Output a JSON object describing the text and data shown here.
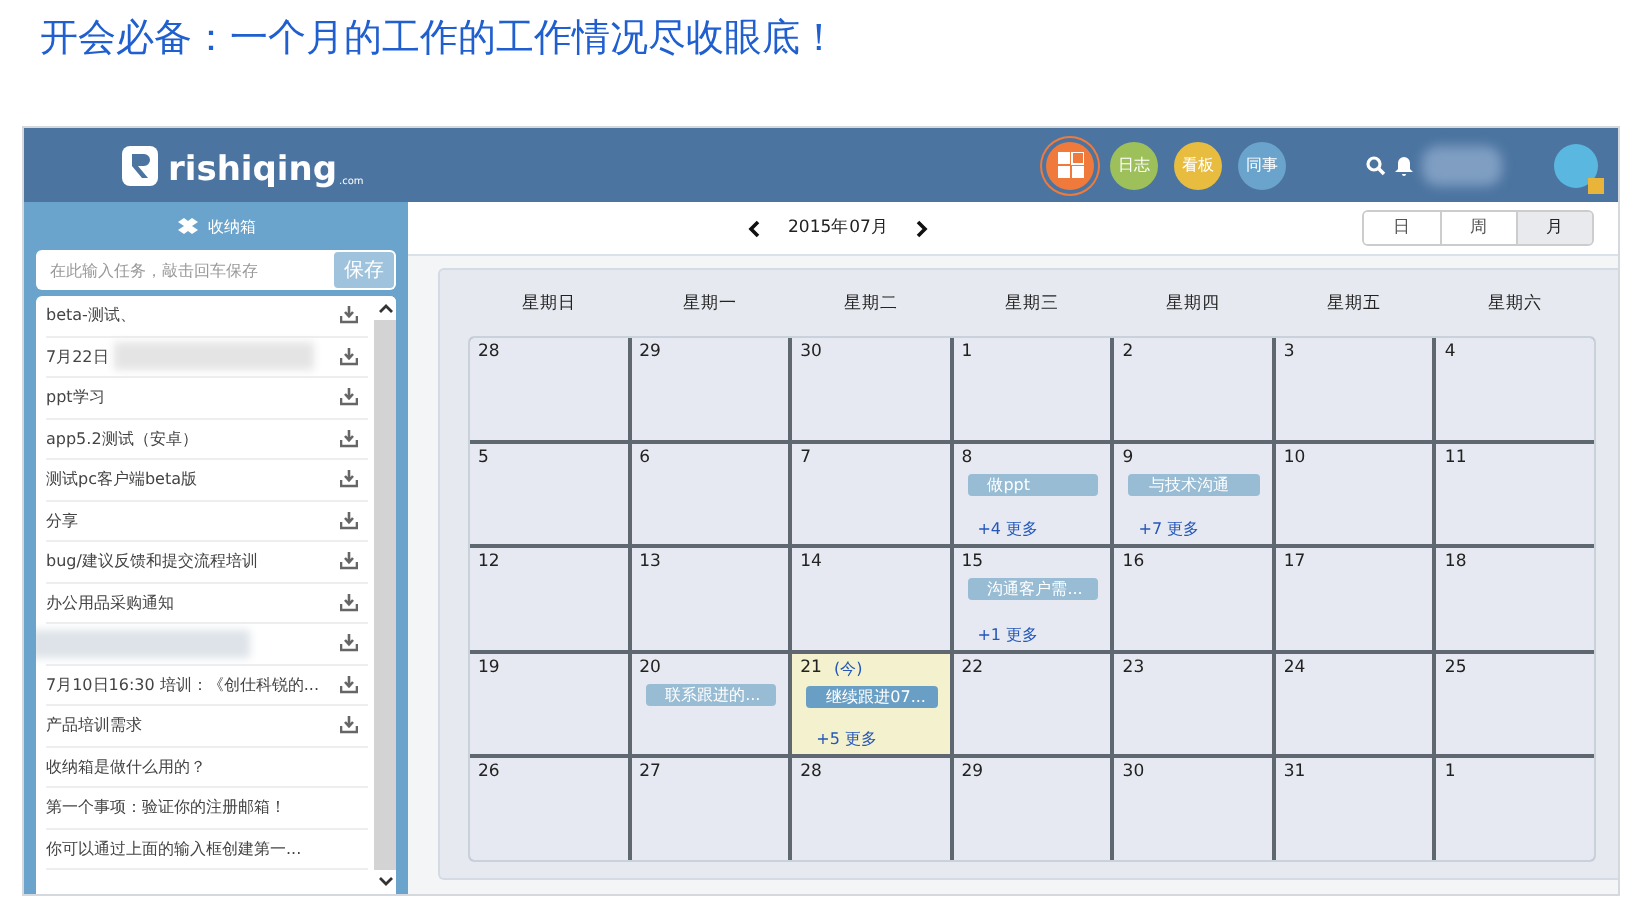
{
  "headline": "开会必备：一个月的工作的工作情况尽收眼底！",
  "header": {
    "logo": {
      "name": "rishiqing",
      "suffix": ".com"
    },
    "nav": [
      {
        "kind": "icon",
        "color": "#f07a3c",
        "selected": true
      },
      {
        "kind": "text",
        "label": "日志",
        "color": "#9dc05a",
        "selected": false
      },
      {
        "kind": "text",
        "label": "看板",
        "color": "#e8bd3f",
        "selected": false
      },
      {
        "kind": "text",
        "label": "同事",
        "color": "#6aa3cb",
        "selected": false
      }
    ]
  },
  "inbox": {
    "title": "收纳箱",
    "placeholder": "在此输入任务，敲击回车保存",
    "save": "保存",
    "items": [
      {
        "text": "beta-测试、",
        "download": true,
        "blurred": false
      },
      {
        "text": "7月22日",
        "download": true,
        "blurred": true
      },
      {
        "text": "ppt学习",
        "download": true,
        "blurred": false
      },
      {
        "text": "app5.2测试（安卓）",
        "download": true,
        "blurred": false
      },
      {
        "text": "测试pc客户端beta版",
        "download": true,
        "blurred": false
      },
      {
        "text": "分享",
        "download": true,
        "blurred": false
      },
      {
        "text": "bug/建议反馈和提交流程培训",
        "download": true,
        "blurred": false
      },
      {
        "text": "办公用品采购通知",
        "download": true,
        "blurred": false
      },
      {
        "download": true,
        "blurred": true
      },
      {
        "text": "7月10日16:30 培训：《创仕科锐的...",
        "download": true,
        "blurred": false
      },
      {
        "text": "产品培训需求",
        "download": true,
        "blurred": false
      },
      {
        "text": "收纳箱是做什么用的？",
        "download": false,
        "blurred": false
      },
      {
        "text": "第一个事项：验证你的注册邮箱！",
        "download": false,
        "blurred": false
      },
      {
        "text": "你可以通过上面的输入框创建第一...",
        "download": false,
        "blurred": false
      }
    ]
  },
  "calendar": {
    "title": "2015年07月",
    "views": [
      {
        "label": "日",
        "selected": false
      },
      {
        "label": "周",
        "selected": false
      },
      {
        "label": "月",
        "selected": true
      }
    ],
    "weekdays": [
      "星期日",
      "星期一",
      "星期二",
      "星期三",
      "星期四",
      "星期五",
      "星期六"
    ],
    "weeks": [
      [
        {
          "day": "28",
          "today": false
        },
        {
          "day": "29",
          "today": false
        },
        {
          "day": "30",
          "today": false
        },
        {
          "day": "1",
          "today": false
        },
        {
          "day": "2",
          "today": false
        },
        {
          "day": "3",
          "today": false
        },
        {
          "day": "4",
          "today": false
        }
      ],
      [
        {
          "day": "5",
          "today": false
        },
        {
          "day": "6",
          "today": false
        },
        {
          "day": "7",
          "today": false
        },
        {
          "day": "8",
          "today": false,
          "events": [
            {
              "text": "做ppt",
              "color": "#98bcd4"
            }
          ],
          "more": "+4 更多"
        },
        {
          "day": "9",
          "today": false,
          "events": [
            {
              "text": "与技术沟通",
              "color": "#98bcd4"
            }
          ],
          "more": "+7 更多"
        },
        {
          "day": "10",
          "today": false
        },
        {
          "day": "11",
          "today": false
        }
      ],
      [
        {
          "day": "12",
          "today": false
        },
        {
          "day": "13",
          "today": false
        },
        {
          "day": "14",
          "today": false
        },
        {
          "day": "15",
          "today": false,
          "events": [
            {
              "text": "沟通客户需...",
              "color": "#98bcd4"
            }
          ],
          "more": "+1 更多"
        },
        {
          "day": "16",
          "today": false
        },
        {
          "day": "17",
          "today": false
        },
        {
          "day": "18",
          "today": false
        }
      ],
      [
        {
          "day": "19",
          "today": false
        },
        {
          "day": "20",
          "today": false,
          "events": [
            {
              "text": "联系跟进的...",
              "color": "#98bcd4"
            }
          ]
        },
        {
          "day": "21",
          "today": true,
          "today_mark": "(今)",
          "events": [
            {
              "text": "继续跟进07...",
              "color": "#6a9fc5"
            }
          ],
          "more": "+5 更多"
        },
        {
          "day": "22",
          "today": false
        },
        {
          "day": "23",
          "today": false
        },
        {
          "day": "24",
          "today": false
        },
        {
          "day": "25",
          "today": false
        }
      ],
      [
        {
          "day": "26",
          "today": false
        },
        {
          "day": "27",
          "today": false
        },
        {
          "day": "28",
          "today": false
        },
        {
          "day": "29",
          "today": false
        },
        {
          "day": "30",
          "today": false
        },
        {
          "day": "31",
          "today": false
        },
        {
          "day": "1",
          "today": false
        }
      ]
    ]
  }
}
